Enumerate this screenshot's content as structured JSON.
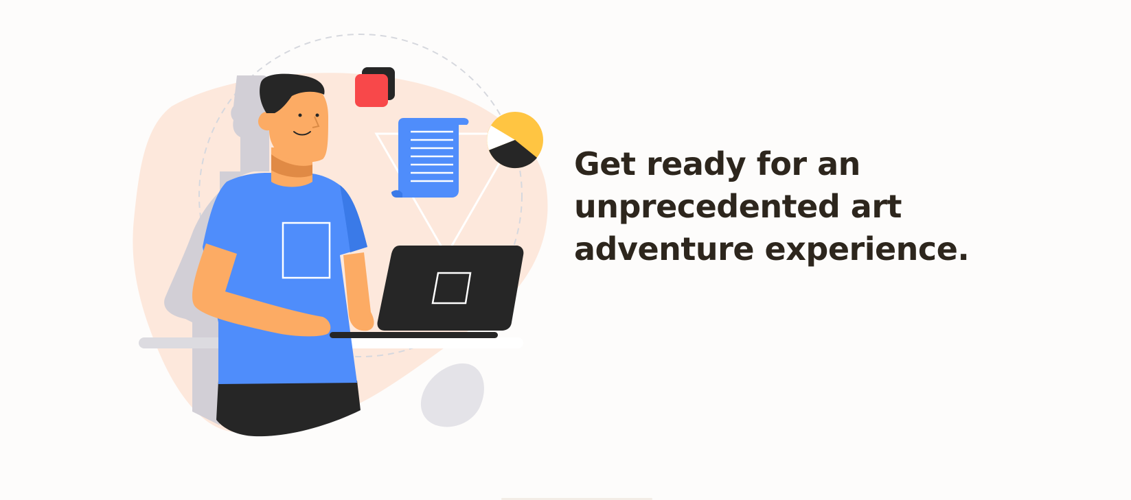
{
  "hero": {
    "headline_lines": [
      "Get ready for an",
      "unprecedented art",
      "adventure experience."
    ]
  },
  "illustration": {
    "subject": "person-working-on-laptop",
    "icons": [
      "red-square-icon",
      "document-scroll-icon",
      "pie-chart-icon",
      "laptop-icon"
    ]
  },
  "colors": {
    "background": "#fdfcfb",
    "blob": "#fde8dc",
    "shirt": "#4f8dfb",
    "skin": "#fcab64",
    "dark": "#262626",
    "accent_red": "#f8484a",
    "accent_yellow": "#ffc542",
    "headline": "#2d261d"
  }
}
